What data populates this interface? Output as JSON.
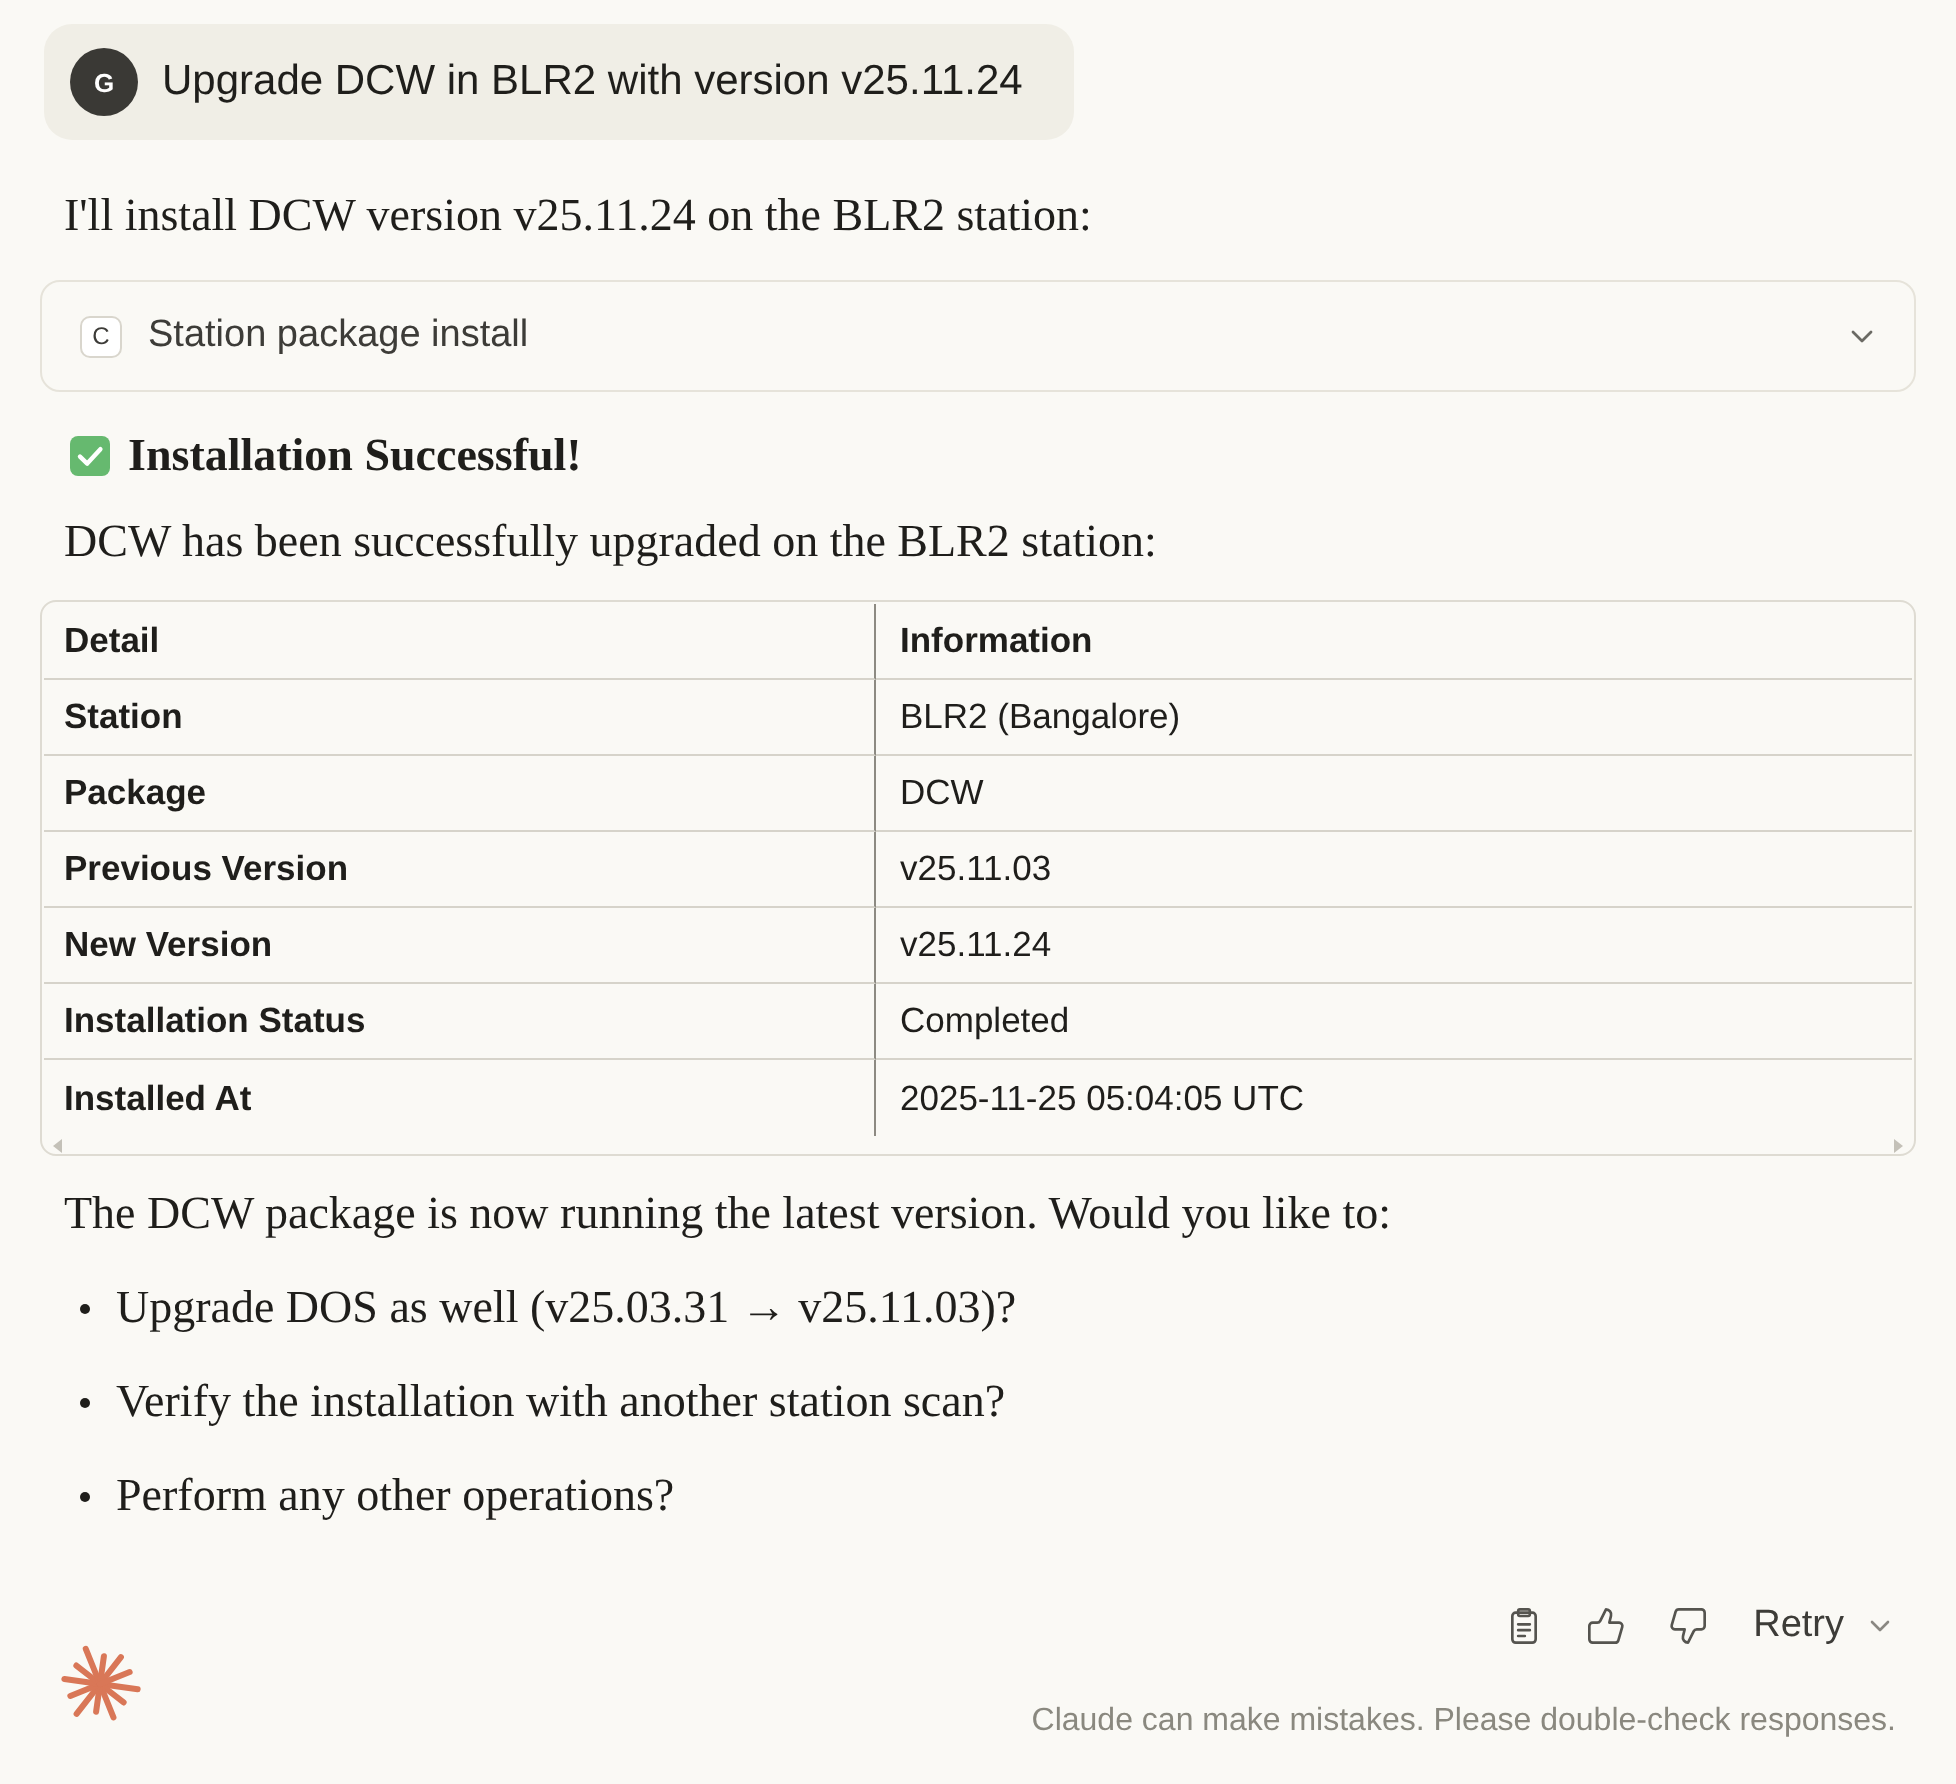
{
  "user_message": {
    "avatar": "G",
    "text": "Upgrade DCW in BLR2 with version v25.11.24"
  },
  "response": {
    "intro": "I'll install DCW version v25.11.24 on the BLR2 station:",
    "tool_call": {
      "icon_letter": "C",
      "label": "Station package install",
      "expanded": false
    },
    "heading": "Installation Successful!",
    "summary": "DCW has been successfully upgraded on the BLR2 station:",
    "table": {
      "columns": [
        "Detail",
        "Information"
      ],
      "rows": [
        [
          "Station",
          "BLR2 (Bangalore)"
        ],
        [
          "Package",
          "DCW"
        ],
        [
          "Previous Version",
          "v25.11.03"
        ],
        [
          "New Version",
          "v25.11.24"
        ],
        [
          "Installation Status",
          "Completed"
        ],
        [
          "Installed At",
          "2025-11-25 05:04:05 UTC"
        ]
      ]
    },
    "followup": "The DCW package is now running the latest version. Would you like to:",
    "options": [
      "Upgrade DOS as well (v25.03.31 → v25.11.03)?",
      "Verify the installation with another station scan?",
      "Perform any other operations?"
    ]
  },
  "message_actions": {
    "retry": "Retry"
  },
  "disclaimer": "Claude can make mistakes. Please double-check responses."
}
